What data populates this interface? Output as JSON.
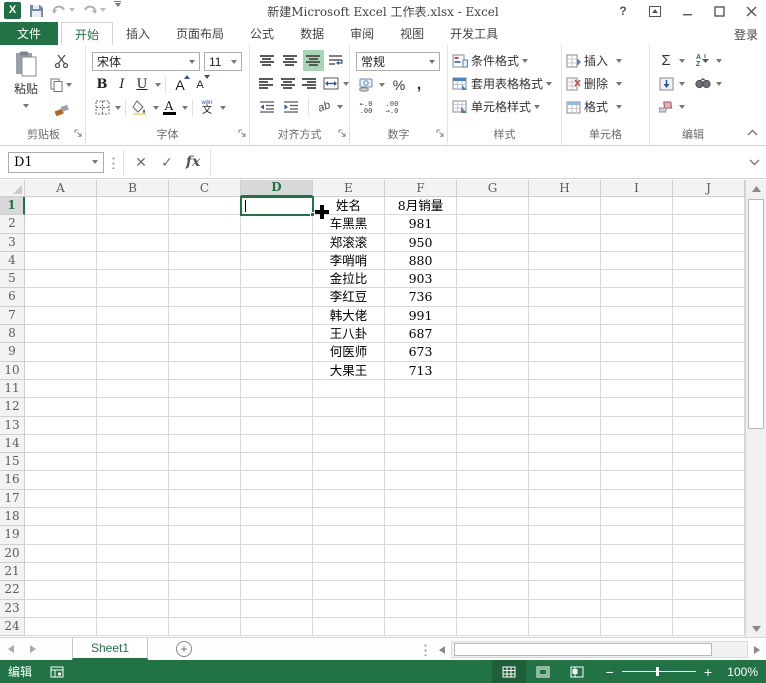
{
  "title_bar": {
    "title": "新建Microsoft Excel 工作表.xlsx - Excel",
    "help": "?"
  },
  "tab_bar": {
    "file": "文件",
    "tabs": [
      "开始",
      "插入",
      "页面布局",
      "公式",
      "数据",
      "审阅",
      "视图",
      "开发工具"
    ],
    "active": "开始",
    "sign_in": "登录"
  },
  "ribbon": {
    "clipboard": {
      "label": "剪贴板",
      "paste": "粘贴"
    },
    "font": {
      "label": "字体",
      "name": "宋体",
      "size": "11",
      "bold": "B",
      "italic": "I",
      "underline": "U",
      "grow": "A",
      "shrink": "A",
      "color_a": "A",
      "phonetic_top": "wén",
      "phonetic": "文"
    },
    "alignment": {
      "label": "对齐方式",
      "orientation": "ab"
    },
    "number": {
      "label": "数字",
      "format": "常规",
      "percent": "%",
      "comma": ",",
      "inc_top": "←.0",
      "inc_bot": ".00",
      "dec_top": ".00",
      "dec_bot": "→.0"
    },
    "styles": {
      "label": "样式",
      "items": [
        "条件格式",
        "套用表格格式",
        "单元格样式"
      ]
    },
    "cells": {
      "label": "单元格",
      "items": [
        "插入",
        "删除",
        "格式"
      ]
    },
    "editing": {
      "label": "编辑",
      "autosum": "Σ",
      "sort_a": "A",
      "sort_z": "Z"
    }
  },
  "formula_bar": {
    "name_box": "D1",
    "cancel": "✕",
    "enter": "✓",
    "fx": "fx",
    "formula": ""
  },
  "grid": {
    "columns": [
      "A",
      "B",
      "C",
      "D",
      "E",
      "F",
      "G",
      "H",
      "I",
      "J"
    ],
    "row_count": 24,
    "selected_column": "D",
    "selected_row": 1,
    "active_cell": "D1",
    "cells": {
      "E1": "姓名",
      "F1": "8月销量",
      "E2": "车黑黑",
      "F2": "981",
      "E3": "郑滚滚",
      "F3": "950",
      "E4": "李哨哨",
      "F4": "880",
      "E5": "金拉比",
      "F5": "903",
      "E6": "李红豆",
      "F6": "736",
      "E7": "韩大佬",
      "F7": "991",
      "E8": "王八卦",
      "F8": "687",
      "E9": "何医师",
      "F9": "673",
      "E10": "大果王",
      "F10": "713"
    }
  },
  "sheet_bar": {
    "tabs": [
      "Sheet1"
    ],
    "active": "Sheet1"
  },
  "status_bar": {
    "mode": "编辑",
    "zoom_minus": "−",
    "zoom_plus": "+",
    "zoom_level": "100%"
  }
}
